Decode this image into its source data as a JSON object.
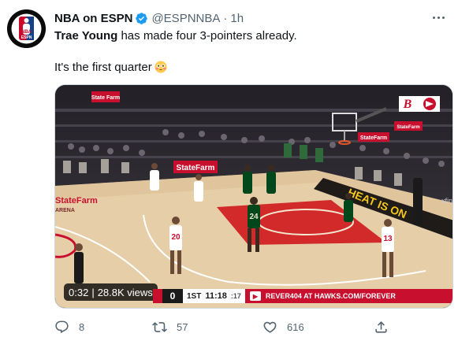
{
  "tweet": {
    "author": {
      "display_name": "NBA on ESPN",
      "handle": "@ESPNNBA",
      "separator": "·",
      "time": "1h",
      "verified": true,
      "avatar_icon": "nba-espn-logo",
      "avatar_text_top": "NBA",
      "avatar_text_bottom": "ESPN"
    },
    "text": {
      "mention": "Trae Young",
      "line1_rest": " has made four 3-pointers already.",
      "line2": "It's the first quarter",
      "line2_emoji": "flushed-face-emoji"
    },
    "media": {
      "type": "video",
      "duration": "0:32",
      "views": "28.8K views",
      "views_separator": "|",
      "scorebug": {
        "score": "0",
        "period": "1ST",
        "clock": "11:18",
        "shot_clock": ":17",
        "promo": "REVER404 AT HAWKS.COM/FOREVER"
      },
      "court_signs": {
        "statefarm_left": "State Farm",
        "statefarm_center": "StateFarm",
        "statefarm_right": "StateFarm",
        "statefarm_small": "StateFarm",
        "arena_floor": "StateFarm",
        "arena_floor_sub": "ARENA",
        "baseline": "HEAT IS ON",
        "xfinity": "xfin",
        "player_1": "20",
        "player_2": "24",
        "player_3": "13"
      }
    },
    "actions": {
      "reply_count": "8",
      "retweet_count": "57",
      "like_count": "616"
    },
    "colors": {
      "verified_blue": "#1d9bf0",
      "secondary_text": "#536471",
      "hawks_red": "#c8102e",
      "bucks_green": "#00471b"
    }
  }
}
